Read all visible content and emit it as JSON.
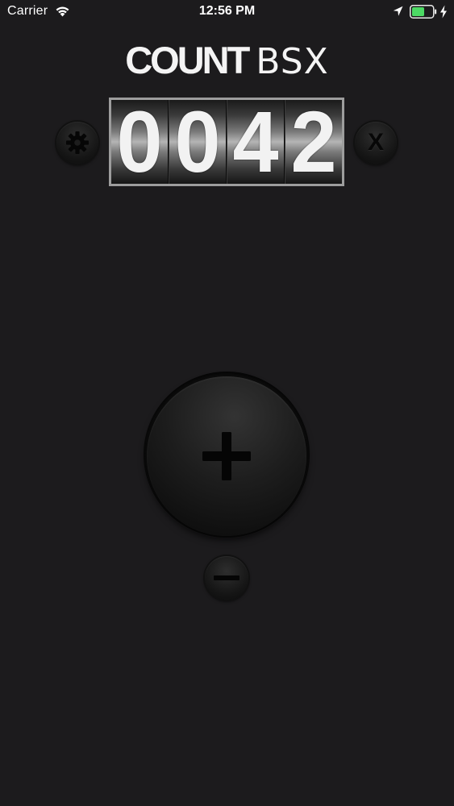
{
  "status_bar": {
    "carrier": "Carrier",
    "time": "12:56 PM",
    "icons": [
      "wifi-icon",
      "location-arrow-icon",
      "battery-icon",
      "charging-bolt-icon"
    ],
    "battery_color": "#4cd964"
  },
  "app": {
    "logo_strong": "COUNT",
    "logo_light": "BSX"
  },
  "counter": {
    "digits": [
      "0",
      "0",
      "4",
      "2"
    ]
  },
  "controls": {
    "settings_icon": "gear-icon",
    "reset_label": "X",
    "increment_icon": "plus-icon",
    "decrement_icon": "minus-icon"
  },
  "colors": {
    "background": "#1c1b1d",
    "digit_text": "#f2f2f2",
    "frame": "#9d9d9d"
  }
}
